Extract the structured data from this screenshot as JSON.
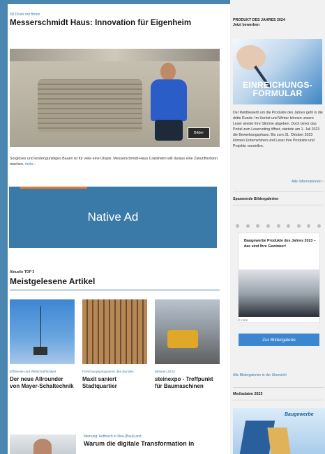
{
  "article": {
    "kicker": "3D Druck mit Beton",
    "title": "Messerschmidt Haus: Innovation für Eigenheim",
    "image_button": "Bilder",
    "teaser": "Sorgloses und kostengünstiges Bauen ist für viele eine Utopie. Messerschmidt-Haus Crailsheim will daraus eine Zukunftsvision machen.",
    "more": "mehr..."
  },
  "native_ad": {
    "label": "Native Ad"
  },
  "top3": {
    "kicker": "Aktuelle TOP 3",
    "title": "Meistgelesene Artikel",
    "cards": [
      {
        "category": "Effiziente und Wirtschaftlichkeit",
        "title": "Der neue Allrounder von Mayer-Schaltechnik"
      },
      {
        "category": "Forschungsprogramm des Bundes",
        "title": "Maxit saniert Stadtquartier"
      },
      {
        "category": "Messen 2023",
        "title": "steinexpo - Treffpunkt für Baumaschinen"
      }
    ]
  },
  "bottom_article": {
    "kicker": "Meinung: Aufbruch in Neu-(Bau)Land",
    "title": "Warum die digitale Transformation in"
  },
  "sidebar": {
    "product_head": "PRODUKT DES JAHRES 2024\nJetzt bewerben",
    "banner_text": "EINREICHUNGS-FORMULAR",
    "body": "Der Wettbewerb um die Produkte des Jahres geht in die dritte Runde. Im Herbst und Winter können unsere Leser wieder ihre Stimme abgeben. Doch bevor das Portal zum Leservoting öffnet, startete am 1. Juli 2023 die Bewerbungsphase. Bis zum 31. Oktober 2023 können Unternehmen und Leser ihre Produkte und Projekte vorstellen.",
    "link": "Alle Informationen",
    "gallery_head": "Spannende Bildergalerien",
    "gallery_title": "Baugewerbe Produkte des Jahres 2023 – das sind Ihre Gewinner!",
    "gallery_credit": "© HWH",
    "gallery_button": "Zur Bildergalerie",
    "gallery_link": "Alle Bildergalerien in der Übersicht",
    "media_head": "Mediadaten 2023",
    "media_logo": "Baugewerbe"
  }
}
